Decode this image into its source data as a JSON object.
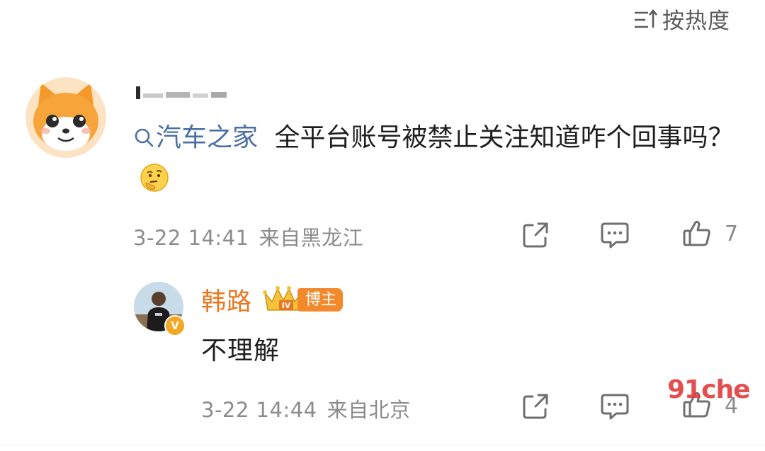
{
  "sort": {
    "label": "按热度",
    "icon": "sort-icon"
  },
  "comment": {
    "username_obscured": true,
    "topic": "汽车之家",
    "text": "全平台账号被禁止关注知道咋个回事吗？",
    "emoji": "thinking-emoji",
    "time": "3-22 14:41",
    "location": "来自黑龙江",
    "likes": "7"
  },
  "reply": {
    "name": "韩路",
    "badge_level": "IV",
    "badge_label": "博主",
    "verified_mark": "V",
    "text": "不理解",
    "time": "3-22 14:44",
    "location": "来自北京",
    "likes": "4"
  },
  "watermark": "91che",
  "colors": {
    "name_orange": "#e8771e",
    "topic_blue": "#4a6fa5",
    "meta_gray": "#8c8c8c",
    "watermark_red": "#e23b3b"
  }
}
